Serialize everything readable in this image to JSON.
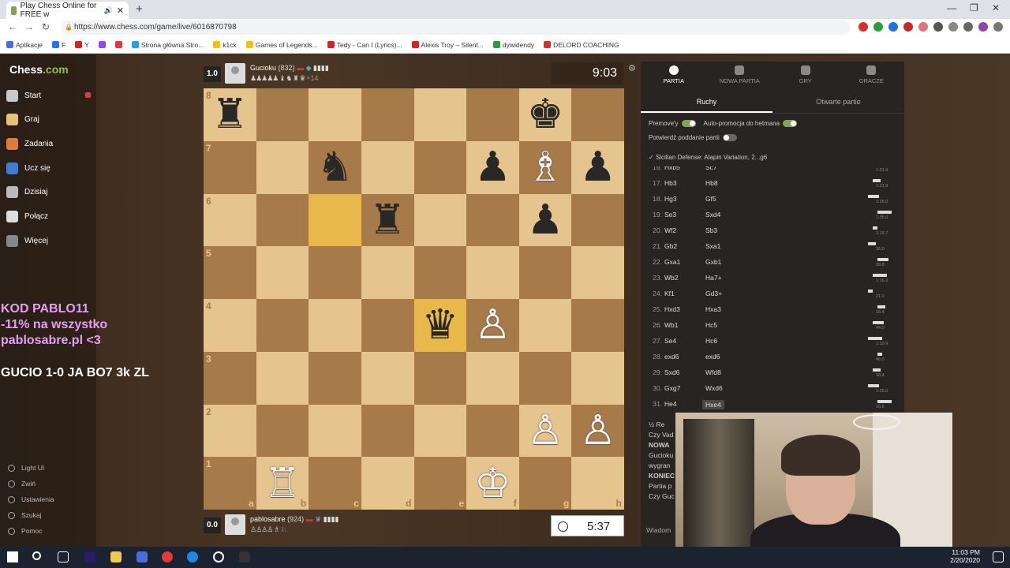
{
  "browser": {
    "tab_title": "Play Chess Online for FREE w",
    "url": "https://www.chess.com/game/live/6016870798",
    "bookmarks": [
      {
        "label": "Aplikacje",
        "color": "#4a6ee0"
      },
      {
        "label": "F",
        "color": "#1877f2"
      },
      {
        "label": "Y",
        "color": "#e02020"
      },
      {
        "label": "",
        "color": "#9146ff"
      },
      {
        "label": "",
        "color": "#e53935"
      },
      {
        "label": "Strona główna Stro...",
        "color": "#1da1f2"
      },
      {
        "label": "k1ck",
        "color": "#f4c20d"
      },
      {
        "label": "Games of Legends...",
        "color": "#f4c20d"
      },
      {
        "label": "Tedy - Can I (Lyrics)...",
        "color": "#e02020"
      },
      {
        "label": "Alexis Troy – Silent...",
        "color": "#e02020"
      },
      {
        "label": "dywidendy",
        "color": "#2e9b3e"
      },
      {
        "label": "DELORD COACHING",
        "color": "#d93025"
      }
    ]
  },
  "sidebar": {
    "logo_word": "Chess",
    "logo_suffix": ".com",
    "items": [
      {
        "label": "Start",
        "color": "#c9c9c9"
      },
      {
        "label": "Graj",
        "color": "#e8c07a"
      },
      {
        "label": "Zadania",
        "color": "#e07b39"
      },
      {
        "label": "Ucz się",
        "color": "#3b7dd8"
      },
      {
        "label": "Dzisiaj",
        "color": "#bbbbbb"
      },
      {
        "label": "Połącz",
        "color": "#dddddd"
      },
      {
        "label": "Więcej",
        "color": "#888888"
      }
    ],
    "bottom_items": [
      "Light UI",
      "Zwiń",
      "Ustawienia",
      "Szukaj",
      "Pomoc"
    ]
  },
  "overlay": {
    "promo_lines": [
      "KOD PABLO11",
      "-11% na wszystko",
      "pablosabre.pl <3"
    ],
    "score_text": "GUCIO 1-0 JA BO7 3k ZL"
  },
  "top_player": {
    "score": "1.0",
    "name": "Gucioku",
    "rating": "(832)",
    "captured": "♟♟♟♟♟ ♝ ♞ ♜ ♛",
    "material": "+14",
    "clock": "9:03"
  },
  "bottom_player": {
    "score": "0.0",
    "name": "pablosabre",
    "rating": "(924)",
    "captured": "♙♙♙♙ ♗ ♘",
    "clock": "5:37"
  },
  "board": {
    "files": [
      "a",
      "b",
      "c",
      "d",
      "e",
      "f",
      "g",
      "h"
    ],
    "ranks": [
      "8",
      "7",
      "6",
      "5",
      "4",
      "3",
      "2",
      "1"
    ],
    "highlight": [
      "c6",
      "e4"
    ],
    "pieces": {
      "a8": "♜",
      "g8": "♚",
      "c7": "♞",
      "f7": "♟",
      "g7": "♗",
      "h7": "♟",
      "d6": "♜",
      "g6": "♟",
      "e4": "♛",
      "f4": "♙",
      "g2": "♙",
      "h2": "♙",
      "b1": "♖",
      "f1": "♔"
    },
    "black_squares": [
      "a8",
      "g8",
      "c7",
      "f7",
      "h7",
      "d6",
      "g6",
      "e4"
    ]
  },
  "panel": {
    "tabs": [
      "PARTIA",
      "NOWA PARTIA",
      "GRY",
      "GRACZE"
    ],
    "subtabs": [
      "Ruchy",
      "Otwarte partie"
    ],
    "premove_label": "Premove'y",
    "autopromo_label": "Auto-promocja do hetmana",
    "confirm_label": "Potwierdź poddanie partii",
    "opening": "Sicilian Defense: Alapin Variation, 2...g6",
    "moves": [
      {
        "n": "16.",
        "w": "Hxb5",
        "b": "Sc7",
        "t": "1:31.9"
      },
      {
        "n": "17.",
        "w": "Hb3",
        "b": "Hb8",
        "t": "1:21.9"
      },
      {
        "n": "18.",
        "w": "Hg3",
        "b": "Gf5",
        "t": "1:35.0"
      },
      {
        "n": "19.",
        "w": "Se3",
        "b": "Sxd4",
        "t": "1:35.0"
      },
      {
        "n": "20.",
        "w": "Wf2",
        "b": "Sb3",
        "t": "1:19.7"
      },
      {
        "n": "21.",
        "w": "Gb2",
        "b": "Sxa1",
        "t": "26.0"
      },
      {
        "n": "22.",
        "w": "Gxa1",
        "b": "Gxb1",
        "t": "39.8"
      },
      {
        "n": "23.",
        "w": "Wb2",
        "b": "Ha7+",
        "t": "1:16.2"
      },
      {
        "n": "24.",
        "w": "Kf1",
        "b": "Gd3+",
        "t": "21.9"
      },
      {
        "n": "25.",
        "w": "Hxd3",
        "b": "Hxa3",
        "t": "18.4"
      },
      {
        "n": "26.",
        "w": "Wb1",
        "b": "Hc5",
        "t": "44.0"
      },
      {
        "n": "27.",
        "w": "Se4",
        "b": "Hc6",
        "t": "1:10.9"
      },
      {
        "n": "28.",
        "w": "exd6",
        "b": "exd6",
        "t": "46.0"
      },
      {
        "n": "29.",
        "w": "Sxd6",
        "b": "Wfd8",
        "t": "18.4"
      },
      {
        "n": "30.",
        "w": "Gxg7",
        "b": "Wxd6",
        "t": "1:25.0"
      },
      {
        "n": "31.",
        "w": "He4",
        "b": "Hxe4",
        "t": "15.6"
      }
    ],
    "result_lines": [
      "½ Re",
      "Czy Vad",
      "NOWA",
      "Gucioku",
      "wygran",
      "KONIEC",
      "Partia p",
      "Czy Guc"
    ],
    "message_label": "Wiadom"
  },
  "taskbar": {
    "time": "11:03 PM",
    "date": "2/20/2020"
  },
  "colors": {
    "accent_green": "#7fa650",
    "board_light": "#e5c48e",
    "board_dark": "#a77a4a",
    "promo_pink": "#e3a0f0"
  }
}
